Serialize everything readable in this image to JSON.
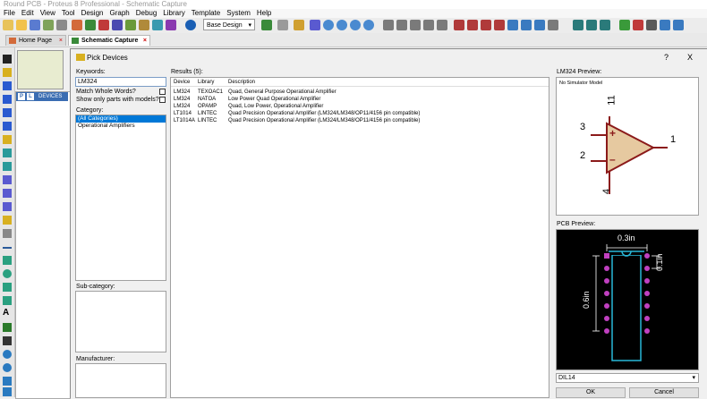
{
  "window": {
    "title": "Round PCB - Proteus 8 Professional - Schematic Capture"
  },
  "menu": [
    "File",
    "Edit",
    "View",
    "Tool",
    "Design",
    "Graph",
    "Debug",
    "Library",
    "Template",
    "System",
    "Help"
  ],
  "toolbar": {
    "design_select": "Base Design"
  },
  "tabs": [
    {
      "label": "Home Page",
      "active": false
    },
    {
      "label": "Schematic Capture",
      "active": true
    }
  ],
  "devices_panel": {
    "btn_p": "P",
    "btn_l": "L",
    "label": "DEVICES"
  },
  "dialog": {
    "title": "Pick Devices",
    "help": "?",
    "close": "X",
    "keywords_label": "Keywords:",
    "keywords_value": "LM324",
    "match_whole_words": "Match Whole Words?",
    "show_only_models": "Show only parts with models?",
    "category_label": "Category:",
    "categories": [
      "(All Categories)",
      "Operational Amplifiers"
    ],
    "subcategory_label": "Sub-category:",
    "manufacturer_label": "Manufacturer:",
    "results_label": "Results (5):",
    "columns": {
      "device": "Device",
      "library": "Library",
      "description": "Description"
    },
    "results": [
      {
        "device": "LM324",
        "library": "TEXOAC1",
        "description": "Quad, General Purpose Operational Amplifier"
      },
      {
        "device": "LM324",
        "library": "NATOA",
        "description": "Low Power Quad Operational Amplifier"
      },
      {
        "device": "LM324",
        "library": "OPAMP",
        "description": "Quad, Low Power, Operational Amplifier"
      },
      {
        "device": "LT1014",
        "library": "LINTEC",
        "description": "Quad Precision Operational Amplifier (LM324/LM348/OP11/4156 pin compatible)"
      },
      {
        "device": "LT1014A",
        "library": "LINTEC",
        "description": "Quad Precision Operational Amplifier (LM324/LM348/OP11/4156 pin compatible)"
      }
    ],
    "preview_label": "LM324 Preview:",
    "no_sim": "No Simulator Model",
    "pins": {
      "vcc": "11",
      "inp": "3",
      "inn": "2",
      "out": "1",
      "gnd": "4"
    },
    "plus": "+",
    "minus": "–",
    "pcb_label": "PCB Preview:",
    "pcb_dims": {
      "width": "0.3in",
      "pitch": "0.1in",
      "height": "0.6in"
    },
    "package": "DIL14",
    "ok": "OK",
    "cancel": "Cancel"
  },
  "colors": {
    "accent": "#0078d7",
    "symbol_fill": "#e6c9a0",
    "symbol_stroke": "#8b1a1a",
    "pcb_bg": "#000000",
    "pad": "#c040c0",
    "outline": "#29b8d8"
  }
}
